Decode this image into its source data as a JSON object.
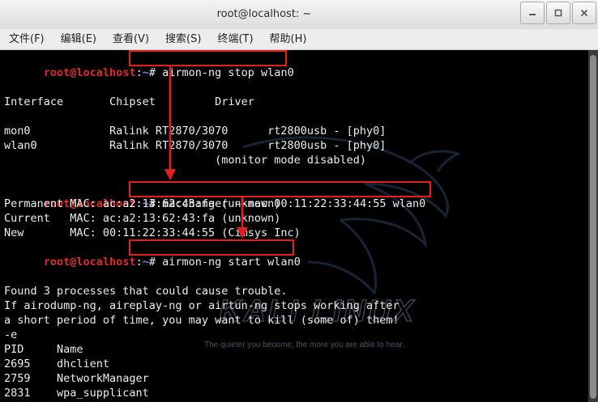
{
  "window": {
    "title": "root@localhost: ~"
  },
  "menu": [
    "文件(F)",
    "编辑(E)",
    "查看(V)",
    "搜索(S)",
    "终端(T)",
    "帮助(H)"
  ],
  "prompt": {
    "user_host": "root@localhost",
    "sep": ":",
    "path": "~",
    "symbol": "#"
  },
  "wallpaper": {
    "brand": "KALI LINUX",
    "tagline": "The quieter you become, the more you are able to hear."
  },
  "commands": [
    "airmon-ng stop wlan0",
    "macchanger --mac 00:11:22:33:44:55 wlan0",
    "airmon-ng start wlan0"
  ],
  "output": {
    "header": "Interface       Chipset         Driver",
    "rows": [
      "mon0            Ralink RT2870/3070      rt2800usb - [phy0]",
      "wlan0           Ralink RT2870/3070      rt2800usb - [phy0]",
      "                                (monitor mode disabled)"
    ],
    "mac": [
      "Permanent MAC: ac:a2:13:62:43:fa (unknown)",
      "Current   MAC: ac:a2:13:62:43:fa (unknown)",
      "New       MAC: 00:11:22:33:44:55 (Cimsys Inc)"
    ],
    "trouble": [
      "Found 3 processes that could cause trouble.",
      "If airodump-ng, aireplay-ng or airtun-ng stops working after",
      "a short period of time, you may want to kill (some of) them!",
      "-e"
    ],
    "proc_header": "PID     Name",
    "procs": [
      "2695    dhclient",
      "2759    NetworkManager",
      "2831    wpa_supplicant"
    ]
  },
  "colors": {
    "annotation": "#e41d1d",
    "prompt_user": "#e02a2a",
    "prompt_path": "#5a8dee",
    "terminal_bg": "#000000"
  }
}
